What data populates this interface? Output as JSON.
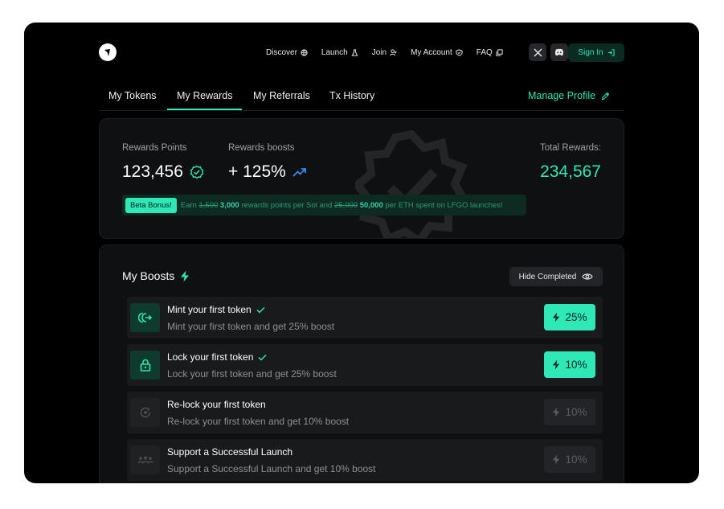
{
  "nav": {
    "links": [
      {
        "label": "Discover",
        "icon": "globe-icon"
      },
      {
        "label": "Launch",
        "icon": "flask-icon"
      },
      {
        "label": "Join",
        "icon": "add-user-icon"
      },
      {
        "label": "My Account",
        "icon": "shield-icon"
      },
      {
        "label": "FAQ",
        "icon": "copy-icon"
      }
    ],
    "social": [
      "x-icon",
      "discord-icon"
    ],
    "signin_label": "Sign In"
  },
  "tabs": {
    "items": [
      "My Tokens",
      "My Rewards",
      "My Referrals",
      "Tx History"
    ],
    "active_index": 1,
    "manage_label": "Manage Profile"
  },
  "rewards": {
    "points_label": "Rewards Points",
    "points_value": "123,456",
    "boosts_label": "Rewards boosts",
    "boosts_value": "+ 125%",
    "total_label": "Total Rewards:",
    "total_value": "234,567",
    "beta": {
      "badge": "Beta Bonus!",
      "t1": "Earn",
      "old1": "1,500",
      "new1": "3,000",
      "t2": "rewards points per Sol and",
      "old2": "25,000",
      "new2": "50,000",
      "t3": "per ETH spent on LFGO launches!"
    }
  },
  "boosts": {
    "title": "My Boosts",
    "hide_label": "Hide Completed",
    "items": [
      {
        "title": "Mint your first token",
        "subtitle": "Mint your first token and get 25% boost",
        "pct": "25%",
        "completed": true,
        "icon": "mint-icon"
      },
      {
        "title": "Lock your first token",
        "subtitle": "Lock your first token and get 25% boost",
        "pct": "10%",
        "completed": true,
        "icon": "lock-icon"
      },
      {
        "title": "Re-lock your first token",
        "subtitle": "Re-lock your first token and get 10% boost",
        "pct": "10%",
        "completed": false,
        "icon": "relock-icon"
      },
      {
        "title": "Support a Successful Launch",
        "subtitle": "Support a Successful Launch and get 10% boost",
        "pct": "10%",
        "completed": false,
        "icon": "users-icon"
      }
    ]
  },
  "colors": {
    "accent": "#2ee8b6",
    "background": "#000000",
    "card": "#0f1011",
    "trend_blue": "#3b8cf0"
  }
}
